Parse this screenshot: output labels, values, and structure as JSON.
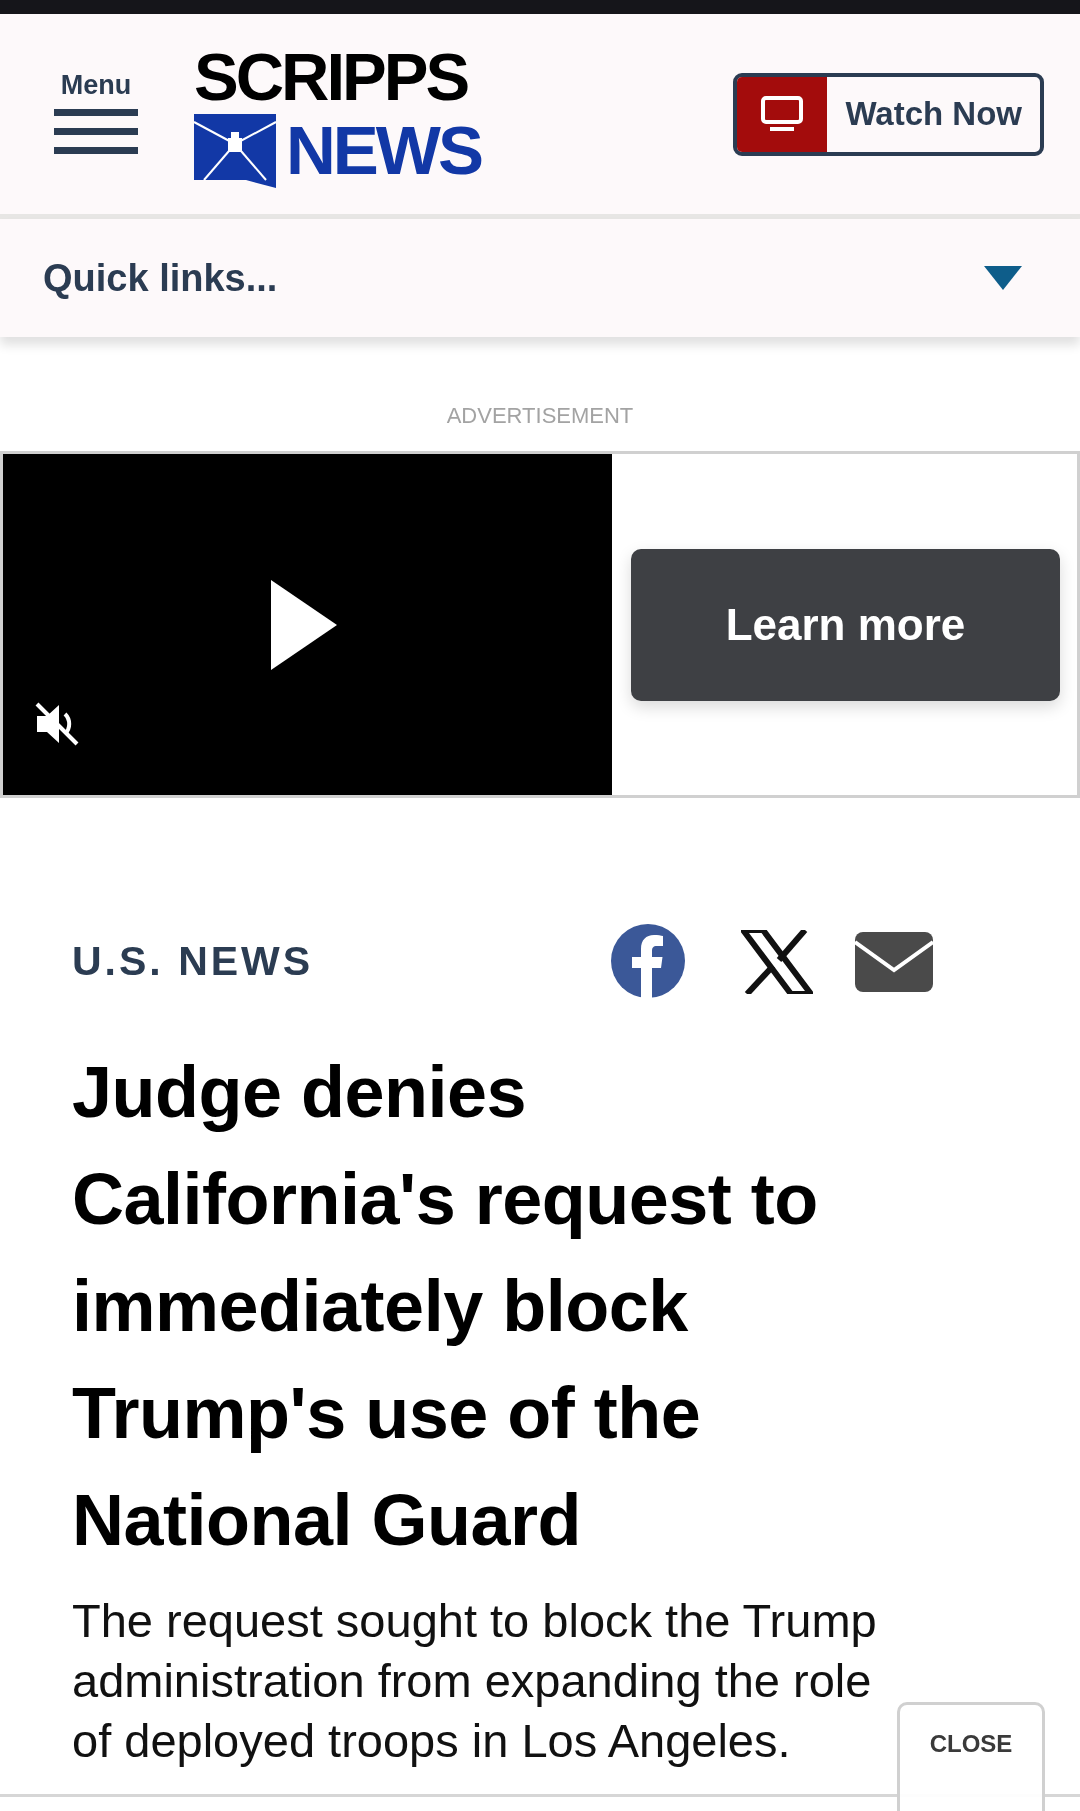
{
  "header": {
    "menu_label": "Menu",
    "logo": {
      "line_1": "SCRIPPS",
      "line_2": "NEWS"
    },
    "watch_button": "Watch Now"
  },
  "quick_links": {
    "label": "Quick links...",
    "expanded": false
  },
  "advertisement": {
    "label": "ADVERTISEMENT",
    "video": {
      "muted": true
    },
    "cta": "Learn more"
  },
  "article": {
    "category": "U.S. NEWS",
    "share": [
      {
        "kind": "facebook"
      },
      {
        "kind": "x"
      },
      {
        "kind": "email"
      }
    ],
    "headline": "Judge denies California's request to immediately block Trump's use of the National Guard",
    "summary": "The request sought to block the Trump administration from expanding the role of deployed troops in Los Angeles."
  },
  "overlay": {
    "close_label": "CLOSE"
  }
}
